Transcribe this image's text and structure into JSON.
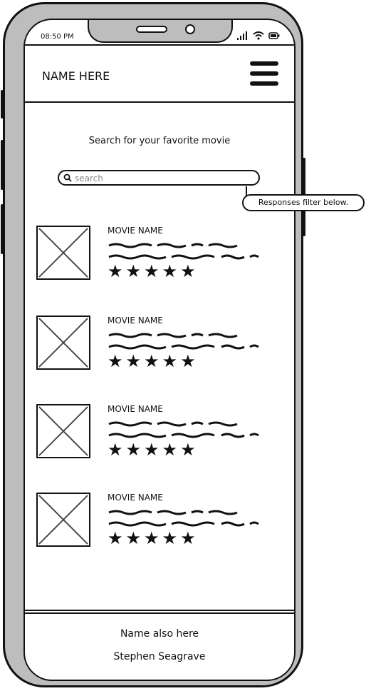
{
  "status_bar": {
    "time": "08:50 PM"
  },
  "header": {
    "title": "NAME HERE"
  },
  "search_section": {
    "prompt": "Search for your favorite movie",
    "placeholder": "search"
  },
  "movies": [
    {
      "name": "MOVIE NAME",
      "rating": 5
    },
    {
      "name": "MOVIE NAME",
      "rating": 5
    },
    {
      "name": "MOVIE NAME",
      "rating": 5
    },
    {
      "name": "MOVIE NAME",
      "rating": 5
    }
  ],
  "footer": {
    "line1": "Name also here",
    "line2": "Stephen Seagrave"
  },
  "annotation": {
    "text": "Responses filter below."
  },
  "icons": {
    "menu": "hamburger-icon",
    "search": "search-icon",
    "signal": "signal-icon",
    "wifi": "wifi-icon",
    "battery": "battery-icon",
    "star": "star-icon",
    "image": "image-placeholder-icon"
  }
}
